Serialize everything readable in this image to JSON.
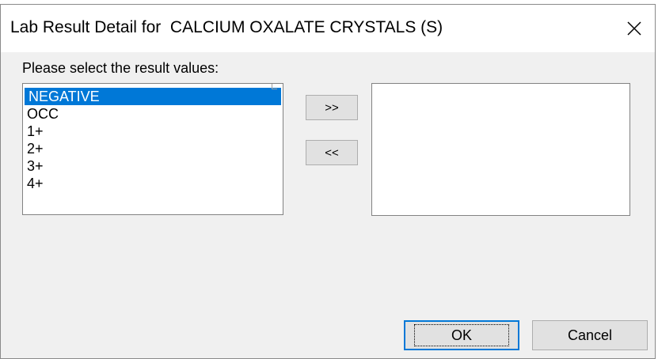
{
  "dialog": {
    "title": "Lab Result Detail for  CALCIUM OXALATE CRYSTALS (S)",
    "prompt": "Please select the result values:",
    "close_icon": "close-icon"
  },
  "source_list": {
    "items": [
      {
        "label": "NEGATIVE",
        "selected": true
      },
      {
        "label": "OCC",
        "selected": false
      },
      {
        "label": "1+",
        "selected": false
      },
      {
        "label": "2+",
        "selected": false
      },
      {
        "label": "3+",
        "selected": false
      },
      {
        "label": "4+",
        "selected": false
      }
    ]
  },
  "target_list": {
    "items": []
  },
  "buttons": {
    "add": ">>",
    "remove": "<<",
    "ok": "OK",
    "cancel": "Cancel"
  },
  "colors": {
    "selection": "#0078d7",
    "dialog_bg": "#f0f0f0",
    "titlebar_bg": "#ffffff"
  }
}
